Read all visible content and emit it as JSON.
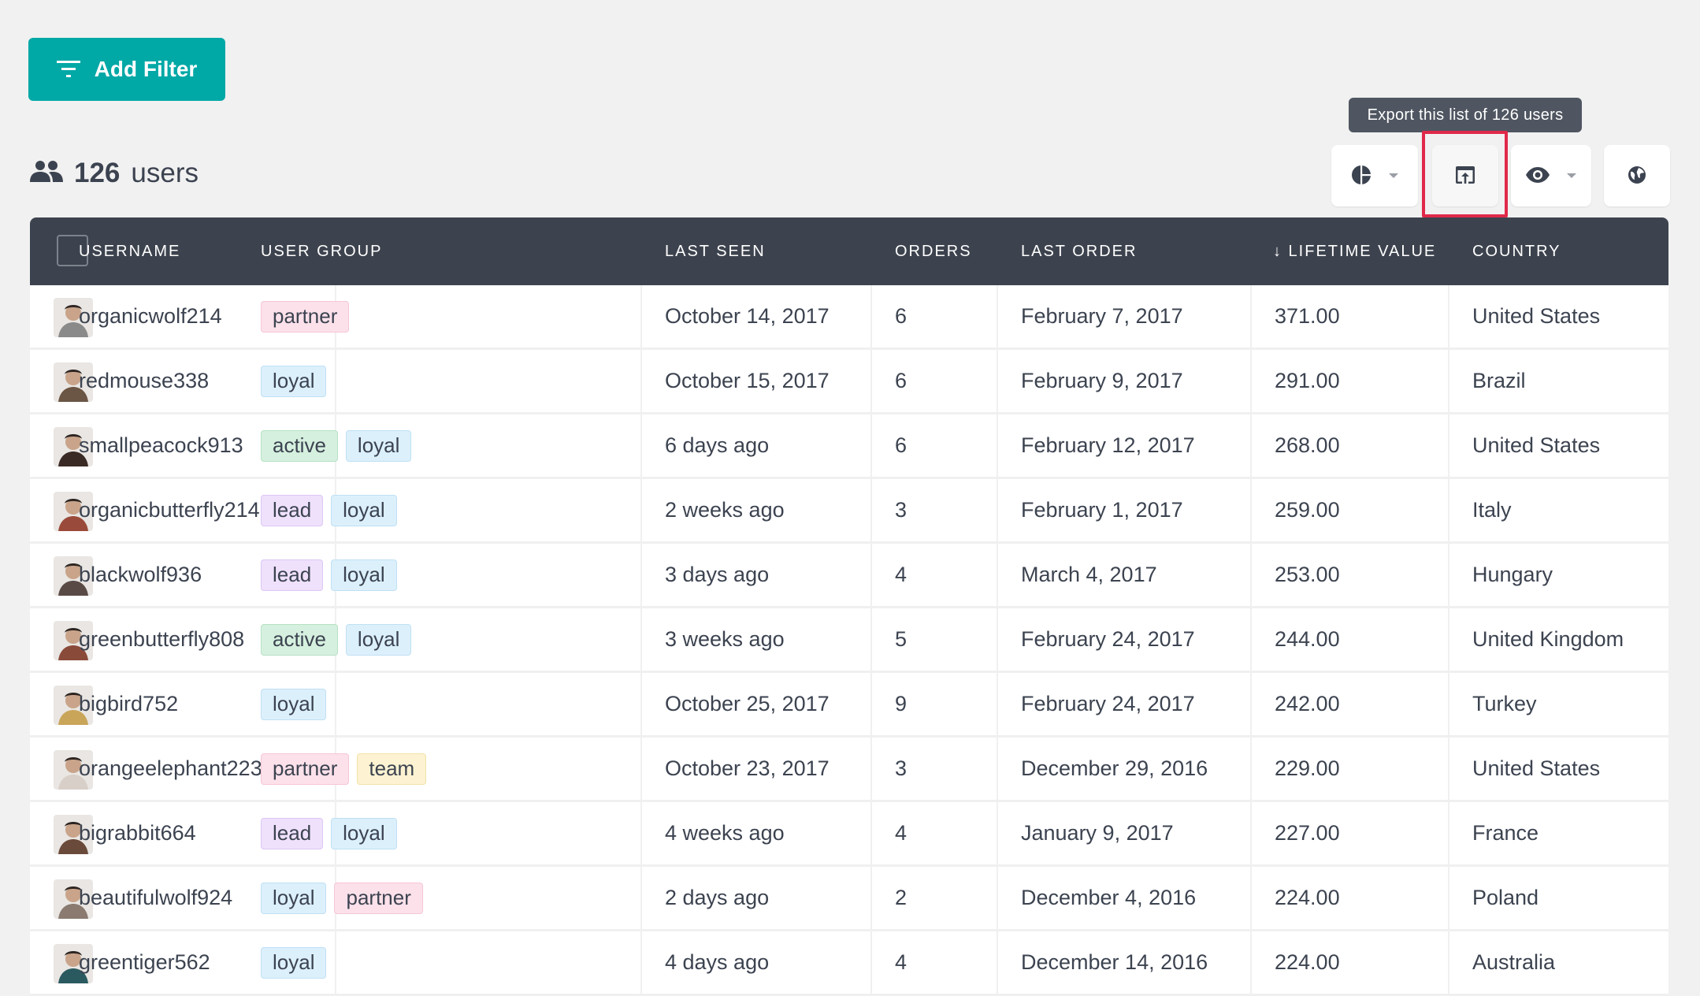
{
  "toolbar": {
    "add_filter_label": "Add Filter",
    "add_filter_color": "#00a8a6",
    "user_count": "126",
    "user_count_suffix": "users",
    "tooltip": "Export this list of 126 users",
    "buttons": [
      {
        "name": "segment-chart",
        "icon": "pie-chart-icon",
        "has_dropdown": true
      },
      {
        "name": "export",
        "icon": "export-icon",
        "has_dropdown": false,
        "highlighted": true
      },
      {
        "name": "view-options",
        "icon": "eye-icon",
        "has_dropdown": true
      },
      {
        "name": "map-view",
        "icon": "globe-icon",
        "has_dropdown": false
      }
    ],
    "highlight_color": "#e0294a"
  },
  "table": {
    "columns": [
      {
        "key": "username",
        "label": "USERNAME"
      },
      {
        "key": "user_group",
        "label": "USER GROUP"
      },
      {
        "key": "last_seen",
        "label": "LAST SEEN"
      },
      {
        "key": "orders",
        "label": "ORDERS"
      },
      {
        "key": "last_order",
        "label": "LAST ORDER"
      },
      {
        "key": "lifetime_value",
        "label": "↓ LIFETIME VALUE",
        "sorted": "descending"
      },
      {
        "key": "country",
        "label": "COUNTRY"
      }
    ],
    "tag_colors": {
      "partner": {
        "bg": "#fce1ea",
        "border": "#f6c6d5"
      },
      "loyal": {
        "bg": "#dcf0fc",
        "border": "#bfe0f3"
      },
      "active": {
        "bg": "#d6f0df",
        "border": "#b5e1c4"
      },
      "lead": {
        "bg": "#efe1fc",
        "border": "#dcc6f3"
      },
      "team": {
        "bg": "#fdf3d2",
        "border": "#f2e2a8"
      }
    },
    "rows": [
      {
        "username": "organicwolf214",
        "groups": [
          "partner"
        ],
        "last_seen": "October 14, 2017",
        "orders": "6",
        "last_order": "February 7, 2017",
        "lifetime_value": "371.00",
        "country": "United States",
        "avatar_color": "#8a8a8a"
      },
      {
        "username": "redmouse338",
        "groups": [
          "loyal"
        ],
        "last_seen": "October 15, 2017",
        "orders": "6",
        "last_order": "February 9, 2017",
        "lifetime_value": "291.00",
        "country": "Brazil",
        "avatar_color": "#6b5544"
      },
      {
        "username": "smallpeacock913",
        "groups": [
          "active",
          "loyal"
        ],
        "last_seen": "6 days ago",
        "orders": "6",
        "last_order": "February 12, 2017",
        "lifetime_value": "268.00",
        "country": "United States",
        "avatar_color": "#3a2a25"
      },
      {
        "username": "organicbutterfly214",
        "groups": [
          "lead",
          "loyal"
        ],
        "last_seen": "2 weeks ago",
        "orders": "3",
        "last_order": "February 1, 2017",
        "lifetime_value": "259.00",
        "country": "Italy",
        "avatar_color": "#9a4a3a"
      },
      {
        "username": "blackwolf936",
        "groups": [
          "lead",
          "loyal"
        ],
        "last_seen": "3 days ago",
        "orders": "4",
        "last_order": "March 4, 2017",
        "lifetime_value": "253.00",
        "country": "Hungary",
        "avatar_color": "#5a4a45"
      },
      {
        "username": "greenbutterfly808",
        "groups": [
          "active",
          "loyal"
        ],
        "last_seen": "3 weeks ago",
        "orders": "5",
        "last_order": "February 24, 2017",
        "lifetime_value": "244.00",
        "country": "United Kingdom",
        "avatar_color": "#8a4a3a"
      },
      {
        "username": "bigbird752",
        "groups": [
          "loyal"
        ],
        "last_seen": "October 25, 2017",
        "orders": "9",
        "last_order": "February 24, 2017",
        "lifetime_value": "242.00",
        "country": "Turkey",
        "avatar_color": "#c9a55a"
      },
      {
        "username": "orangeelephant223",
        "groups": [
          "partner",
          "team"
        ],
        "last_seen": "October 23, 2017",
        "orders": "3",
        "last_order": "December 29, 2016",
        "lifetime_value": "229.00",
        "country": "United States",
        "avatar_color": "#d8cfc8"
      },
      {
        "username": "bigrabbit664",
        "groups": [
          "lead",
          "loyal"
        ],
        "last_seen": "4 weeks ago",
        "orders": "4",
        "last_order": "January 9, 2017",
        "lifetime_value": "227.00",
        "country": "France",
        "avatar_color": "#6a4a3a"
      },
      {
        "username": "beautifulwolf924",
        "groups": [
          "loyal",
          "partner"
        ],
        "last_seen": "2 days ago",
        "orders": "2",
        "last_order": "December 4, 2016",
        "lifetime_value": "224.00",
        "country": "Poland",
        "avatar_color": "#8a7a70"
      },
      {
        "username": "greentiger562",
        "groups": [
          "loyal"
        ],
        "last_seen": "4 days ago",
        "orders": "4",
        "last_order": "December 14, 2016",
        "lifetime_value": "224.00",
        "country": "Australia",
        "avatar_color": "#2a5a60"
      }
    ]
  }
}
